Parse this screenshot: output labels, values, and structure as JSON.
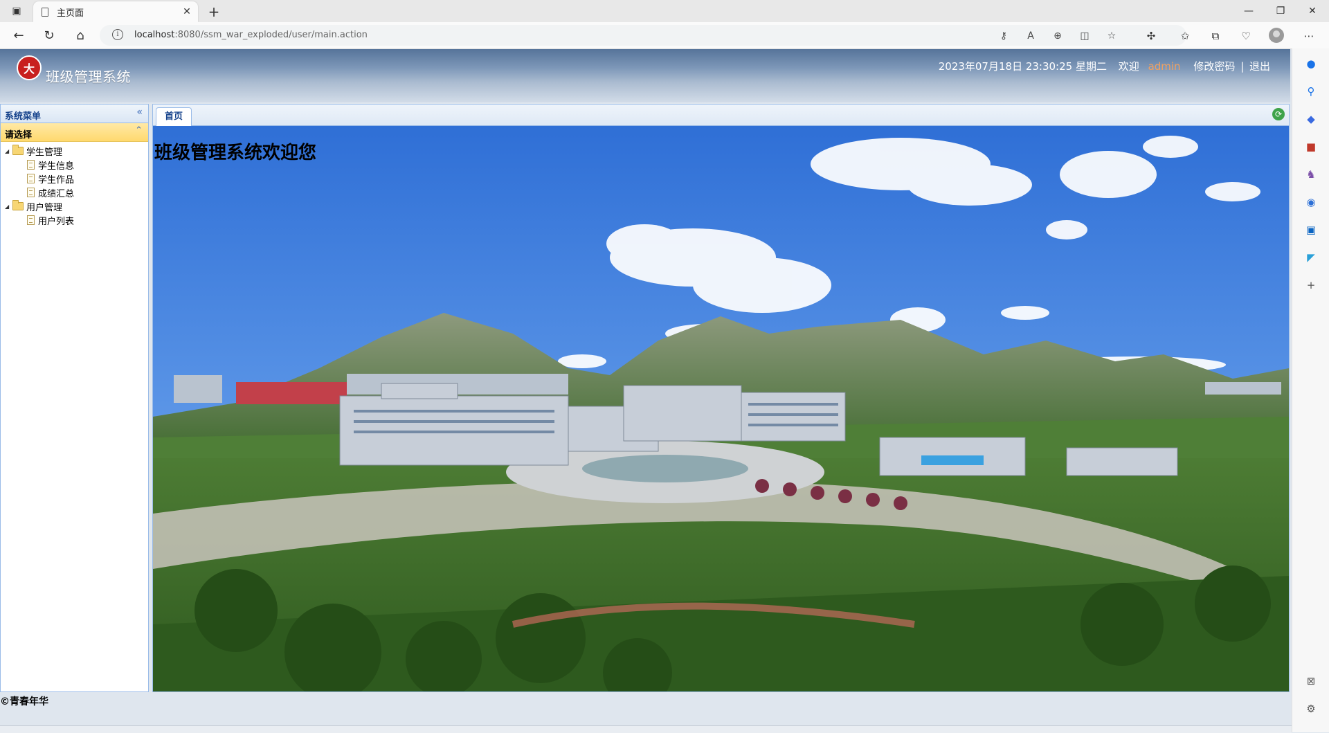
{
  "browser": {
    "tab_title": "主页面",
    "url_host": "localhost",
    "url_rest": ":8080/ssm_war_exploded/user/main.action"
  },
  "header": {
    "app_title": "班级管理系统",
    "logo_text": "大",
    "datetime": "2023年07月18日 23:30:25 星期二",
    "welcome": "欢迎",
    "username": "admin",
    "change_password": "修改密码",
    "separator": "|",
    "logout": "退出"
  },
  "menu": {
    "title": "系统菜单",
    "section": "请选择",
    "groups": [
      {
        "label": "学生管理",
        "items": [
          "学生信息",
          "学生作品",
          "成绩汇总"
        ]
      },
      {
        "label": "用户管理",
        "items": [
          "用户列表"
        ]
      }
    ]
  },
  "main": {
    "tab_label": "首页",
    "welcome_text": "班级管理系统欢迎您"
  },
  "footer": {
    "copyright": "©青春年华"
  },
  "icons": {
    "accent_header": "#56749a",
    "username_color": "#f0a060",
    "panel_border": "#99bbe8"
  }
}
